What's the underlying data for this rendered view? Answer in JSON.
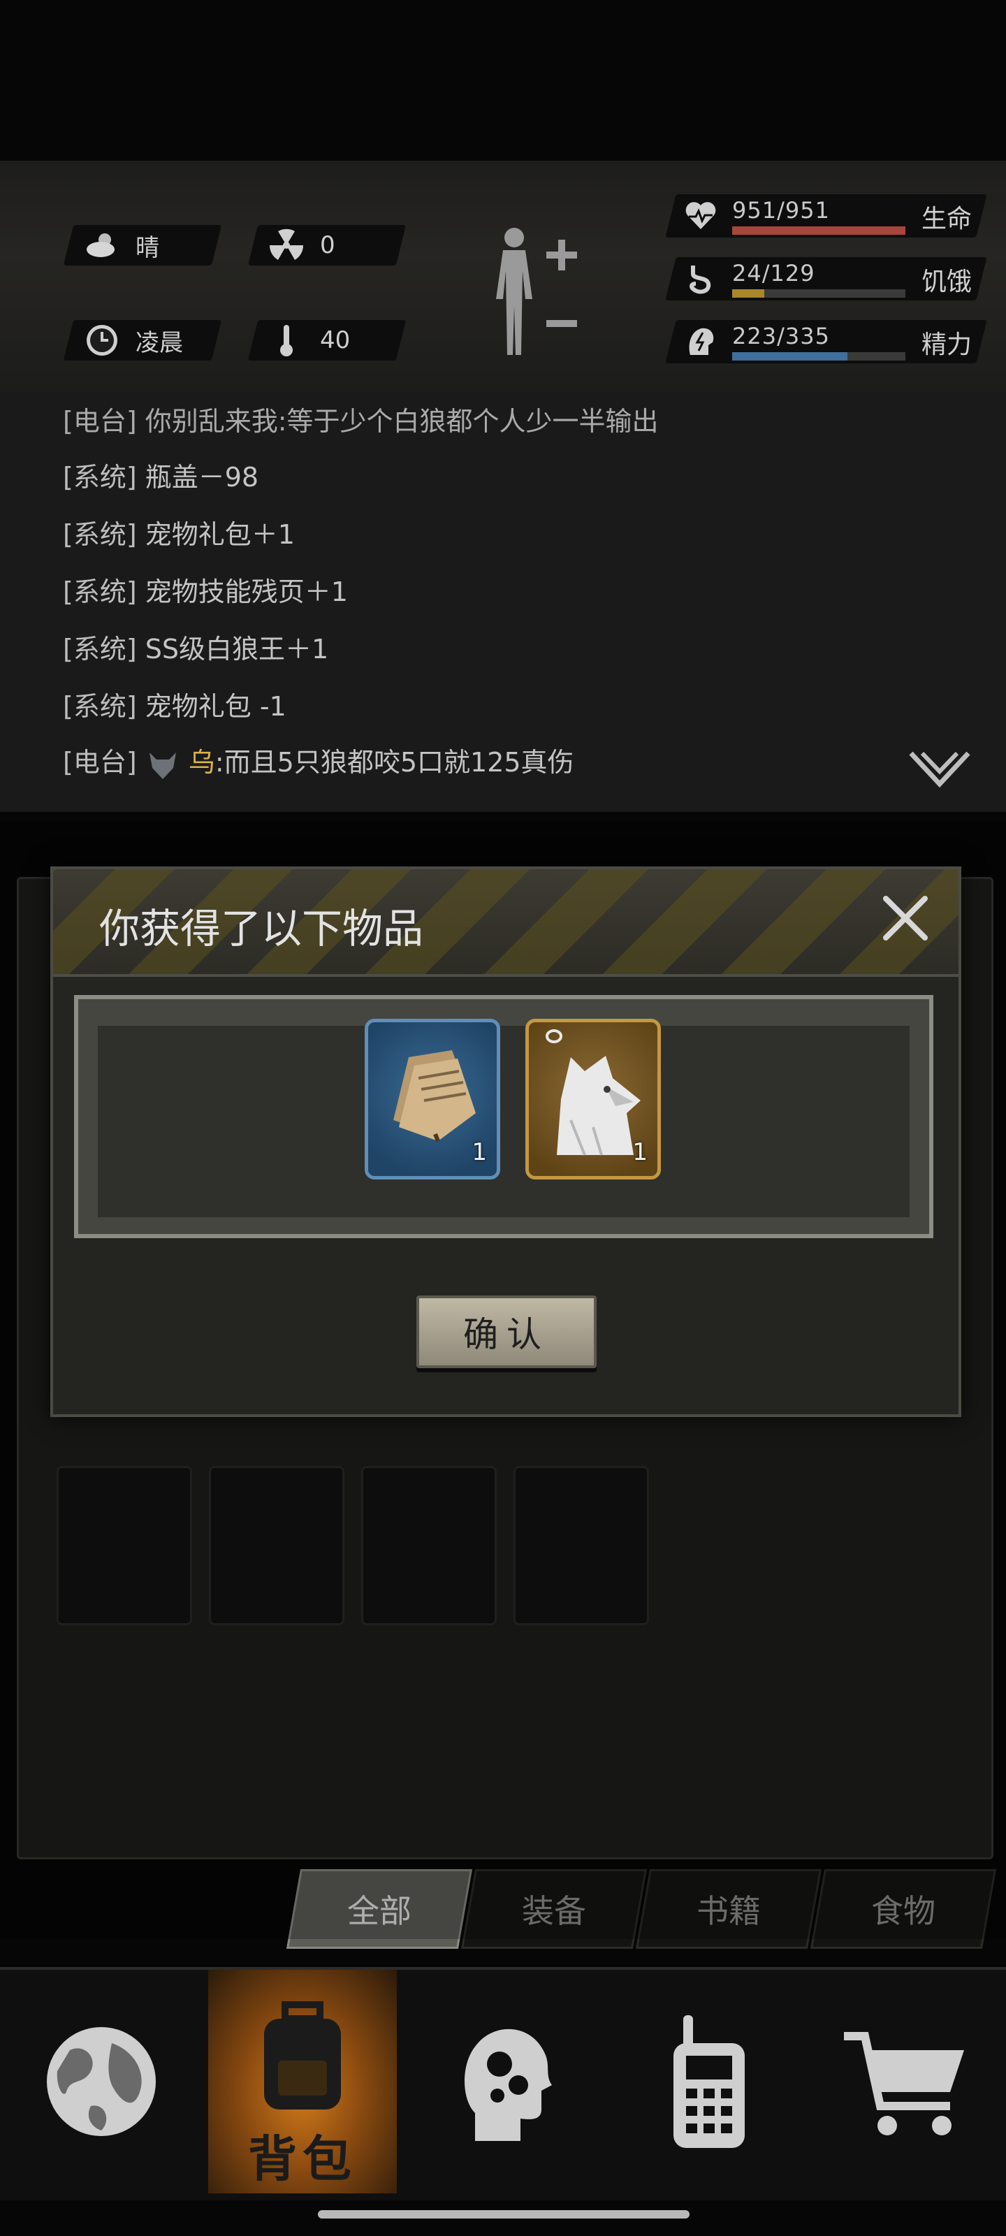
{
  "status": {
    "weather": {
      "icon": "cloud-sun-icon",
      "value": "晴"
    },
    "radiation": {
      "icon": "radiation-icon",
      "value": "0"
    },
    "time": {
      "icon": "clock-icon",
      "value": "凌晨"
    },
    "temperature": {
      "icon": "thermometer-icon",
      "value": "40"
    }
  },
  "vitals": [
    {
      "name": "life",
      "icon": "heart-pulse-icon",
      "text": "951/951",
      "label": "生命",
      "fraction": 1.0,
      "color": "#a8463b"
    },
    {
      "name": "hunger",
      "icon": "stomach-icon",
      "text": "24/129",
      "label": "饥饿",
      "fraction": 0.186,
      "color": "#a9882b"
    },
    {
      "name": "energy",
      "icon": "brain-bolt-icon",
      "text": "223/335",
      "label": "精力",
      "fraction": 0.666,
      "color": "#3f6f9c"
    }
  ],
  "log": {
    "partial_line": "[电台] 你别乱来我:等于少个白狼都个人少一半输出",
    "lines": [
      {
        "tag": "[系统]",
        "text": "瓶盖－98"
      },
      {
        "tag": "[系统]",
        "text": "宠物礼包＋1"
      },
      {
        "tag": "[系统]",
        "text": "宠物技能残页＋1"
      },
      {
        "tag": "[系统]",
        "text": "SS级白狼王＋1"
      },
      {
        "tag": "[系统]",
        "text": "宠物礼包 -1"
      }
    ],
    "radio_line": {
      "tag": "[电台]",
      "name": "乌",
      "text": ":而且5只狼都咬5口就125真伤"
    }
  },
  "modal": {
    "title": "你获得了以下物品",
    "items": [
      {
        "icon": "book-pages-icon",
        "qty": "1",
        "rarity": "blue"
      },
      {
        "icon": "white-wolf-icon",
        "qty": "1",
        "rarity": "gold"
      }
    ],
    "confirm_label": "确认"
  },
  "tabs": [
    {
      "label": "全部",
      "active": true
    },
    {
      "label": "装备",
      "active": false
    },
    {
      "label": "书籍",
      "active": false
    },
    {
      "label": "食物",
      "active": false
    }
  ],
  "nav": {
    "active_label": "背包",
    "items": [
      "globe-icon",
      "backpack-icon",
      "head-gears-icon",
      "radio-icon",
      "cart-icon"
    ]
  }
}
